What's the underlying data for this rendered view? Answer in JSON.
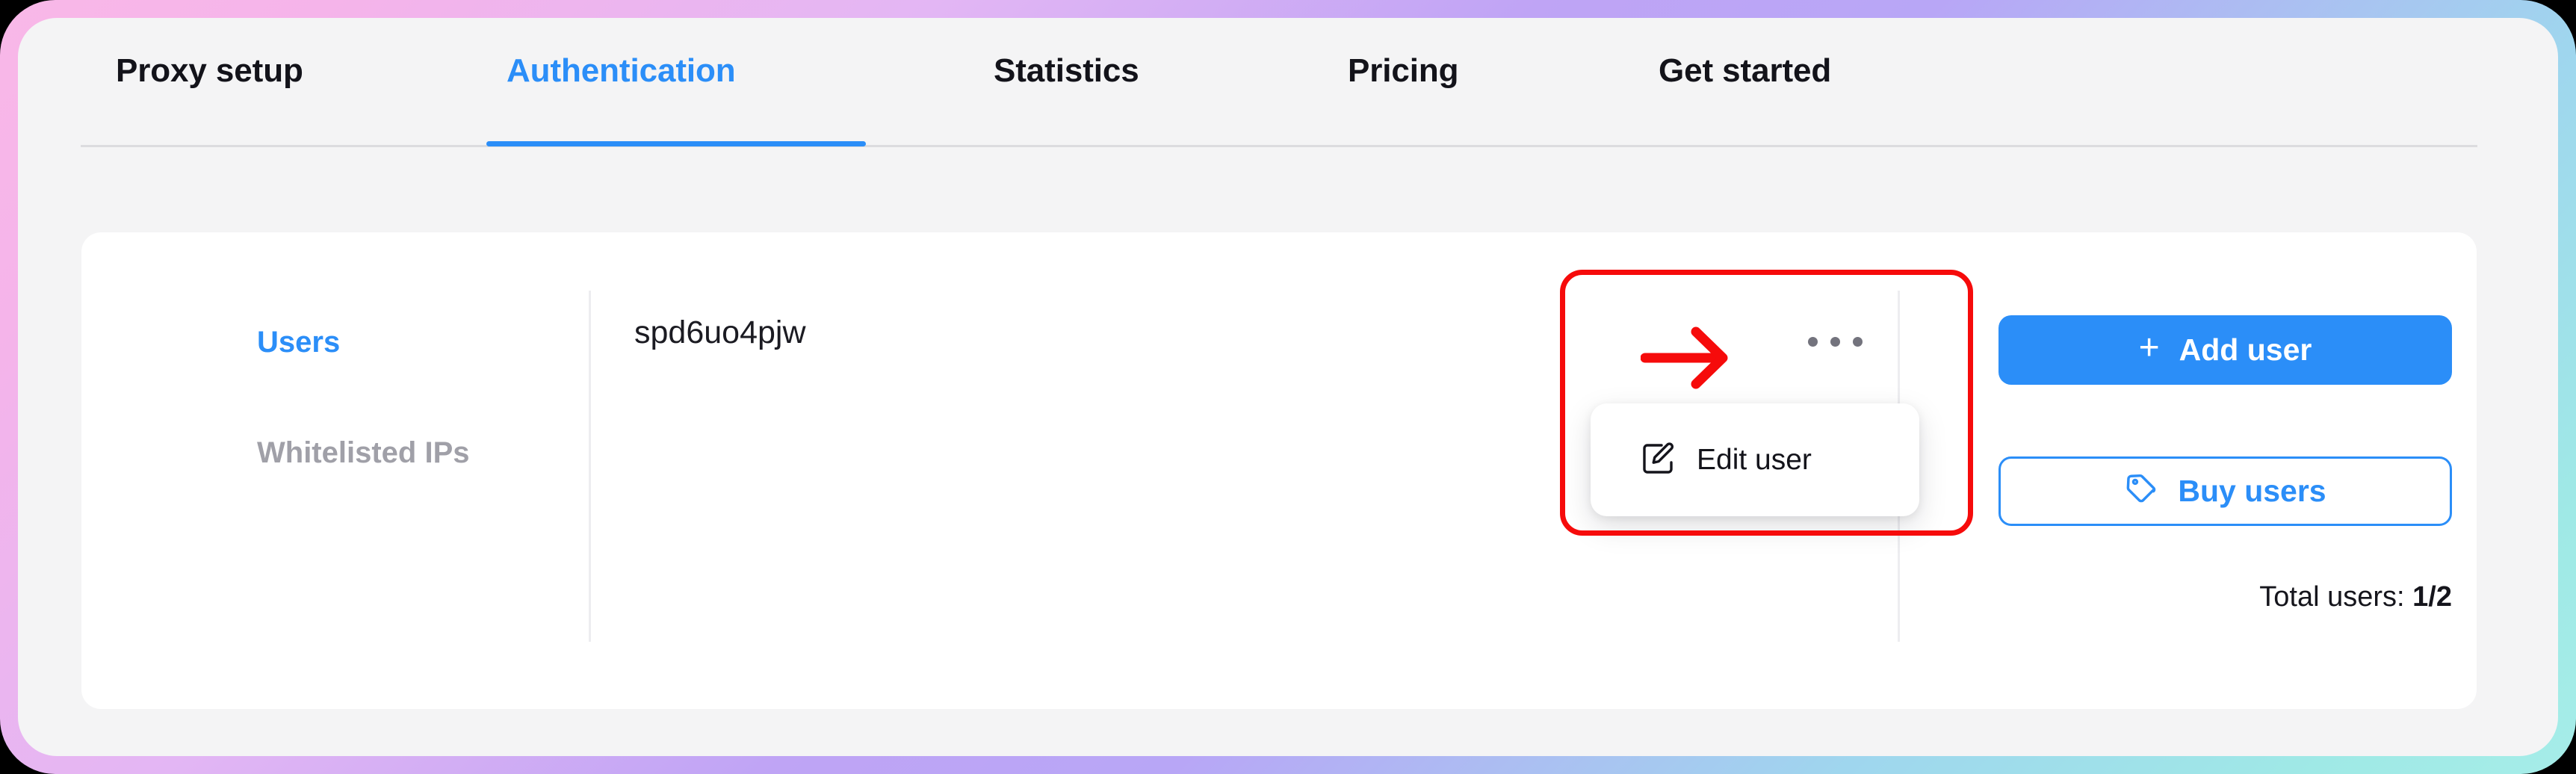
{
  "theme": {
    "accent": "#2b8ef8",
    "text_dark": "#13131a",
    "text_muted": "#a0a0a8",
    "surface": "#f4f4f5",
    "card": "#ffffff",
    "annotation": "#f60b0b",
    "gradient_start": "#f9b8e8",
    "gradient_mid": "#b8a6f6",
    "gradient_end": "#a6ede8"
  },
  "tabs": [
    {
      "label": "Proxy setup",
      "active": false
    },
    {
      "label": "Authentication",
      "active": true
    },
    {
      "label": "Statistics",
      "active": false
    },
    {
      "label": "Pricing",
      "active": false
    },
    {
      "label": "Get started",
      "active": false
    }
  ],
  "side_nav": {
    "items": [
      {
        "label": "Users",
        "active": true
      },
      {
        "label": "Whitelisted IPs",
        "active": false
      }
    ]
  },
  "user_row": {
    "username": "spd6uo4pjw",
    "kebab_icon": "more-horizontal-icon"
  },
  "dropdown": {
    "open": true,
    "items": [
      {
        "label": "Edit user",
        "icon": "edit-square-icon"
      }
    ]
  },
  "actions": {
    "add_user": {
      "label": "Add user",
      "icon": "plus-icon",
      "plus": "+"
    },
    "buy_users": {
      "label": "Buy users",
      "icon": "tag-icon"
    },
    "total_users_label": "Total users: ",
    "total_users_value": "1/2"
  },
  "annotation": {
    "arrow_icon": "right-arrow-icon",
    "highlight_shape": "rounded-rectangle"
  }
}
